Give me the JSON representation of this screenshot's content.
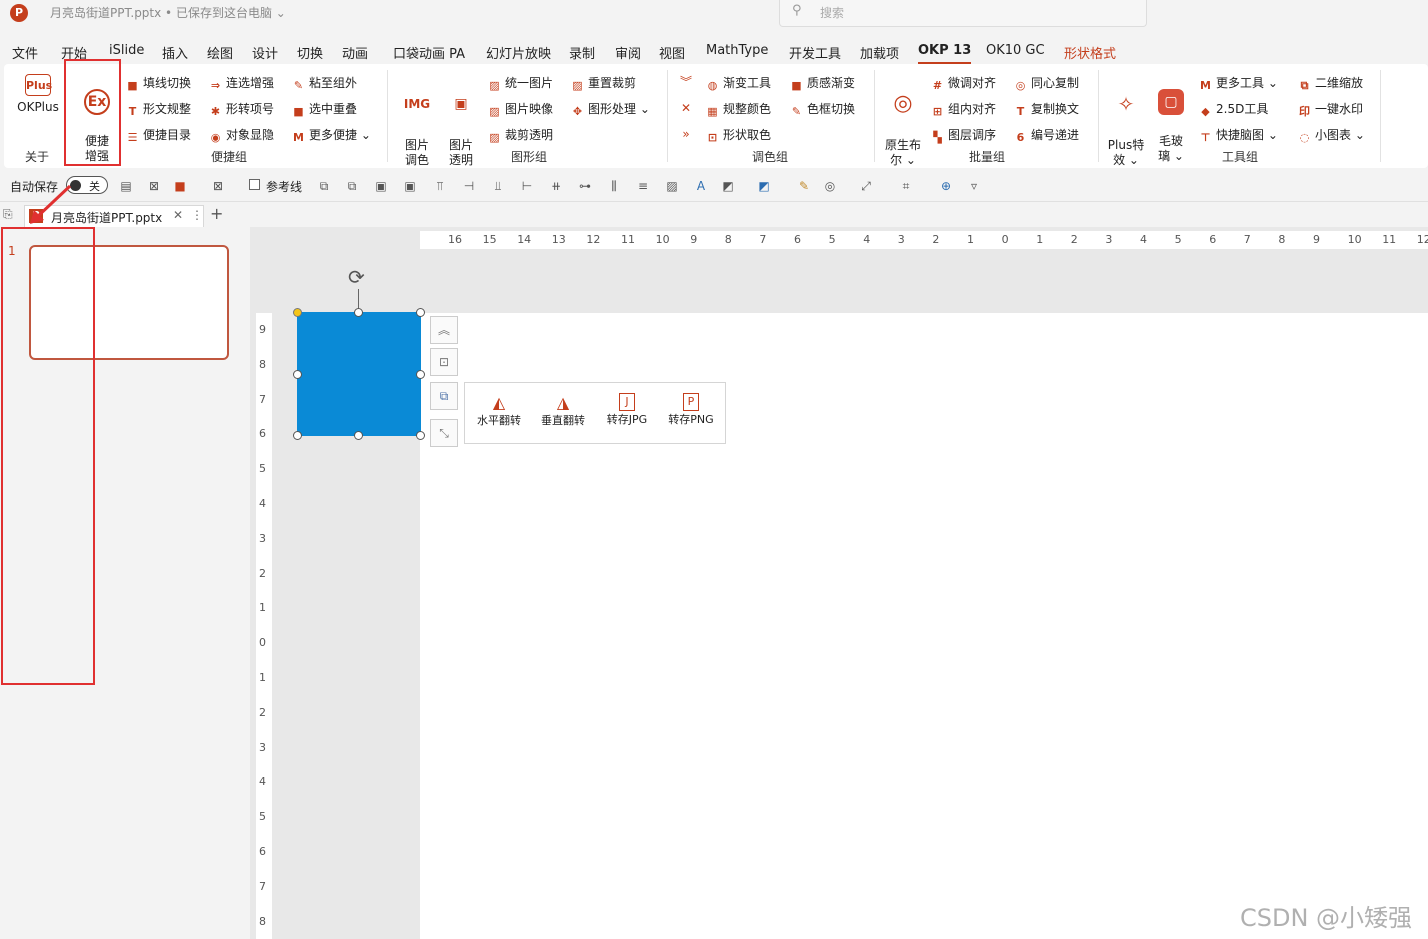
{
  "titlebar": {
    "logo": "P",
    "title": "月亮岛街道PPT.pptx • 已保存到这台电脑 ⌄",
    "search_placeholder": "搜索"
  },
  "menu": {
    "tabs": [
      "文件",
      "开始",
      "iSlide",
      "插入",
      "绘图",
      "设计",
      "切换",
      "动画",
      "口袋动画 PA",
      "幻灯片放映",
      "录制",
      "审阅",
      "视图",
      "MathType",
      "开发工具",
      "加载项",
      "OKP 13",
      "OK10 GC",
      "形状格式"
    ],
    "active": "OKP 13"
  },
  "ribbon": {
    "about": {
      "okplus": "OKPlus",
      "enhance": "便捷\n增强",
      "group": "关于"
    },
    "convenience": {
      "items": [
        "填线切换",
        "连选增强",
        "粘至组外",
        "形文规整",
        "形转项号",
        "选中重叠",
        "便捷目录",
        "对象显隐",
        "更多便捷 ⌄"
      ],
      "group": "便捷组"
    },
    "shape": {
      "pic_color": "图片\n调色",
      "pic_trans": "图片\n透明",
      "items": [
        "统一图片",
        "重置裁剪",
        "图片映像",
        "图形处理 ⌄",
        "裁剪透明"
      ],
      "group": "图形组"
    },
    "color": {
      "items": [
        "渐变工具",
        "质感渐变",
        "规整颜色",
        "色框切换",
        "形状取色"
      ],
      "group": "调色组"
    },
    "batch": {
      "boolean": "原生布\n尔 ⌄",
      "items": [
        "微调对齐",
        "同心复制",
        "组内对齐",
        "复制换文",
        "图层调序",
        "编号递进"
      ],
      "group": "批量组"
    },
    "tools": {
      "plus_effect": "Plus特\n效 ⌄",
      "glass": "毛玻\n璃 ⌄",
      "items": [
        "更多工具 ⌄",
        "二维缩放",
        "2.5D工具",
        "一键水印",
        "快捷脑图",
        "小图表 ⌄"
      ],
      "group": "工具组"
    }
  },
  "qat": {
    "autosave": "自动保存",
    "toggle": "关",
    "guides": "参考线"
  },
  "doctab": {
    "name": "月亮岛街道PPT.pptx"
  },
  "slides": {
    "number": "1"
  },
  "ruler": {
    "h": [
      "16",
      "15",
      "14",
      "13",
      "12",
      "11",
      "10",
      "9",
      "8",
      "7",
      "6",
      "5",
      "4",
      "3",
      "2",
      "1",
      "0",
      "1",
      "2",
      "3",
      "4",
      "5",
      "6",
      "7",
      "8",
      "9",
      "10",
      "11",
      "12"
    ],
    "v": [
      "9",
      "8",
      "7",
      "6",
      "5",
      "4",
      "3",
      "2",
      "1",
      "0",
      "1",
      "2",
      "3",
      "4",
      "5",
      "6",
      "7",
      "8"
    ]
  },
  "shape": {
    "fill": "#0a8ad6"
  },
  "popup": {
    "items": [
      "水平翻转",
      "垂直翻转",
      "转存JPG",
      "转存PNG"
    ],
    "icons": [
      "J",
      "P"
    ]
  },
  "watermark": "CSDN @小矮强",
  "colors": {
    "accent": "#c43e1c",
    "callout": "#e03030"
  }
}
